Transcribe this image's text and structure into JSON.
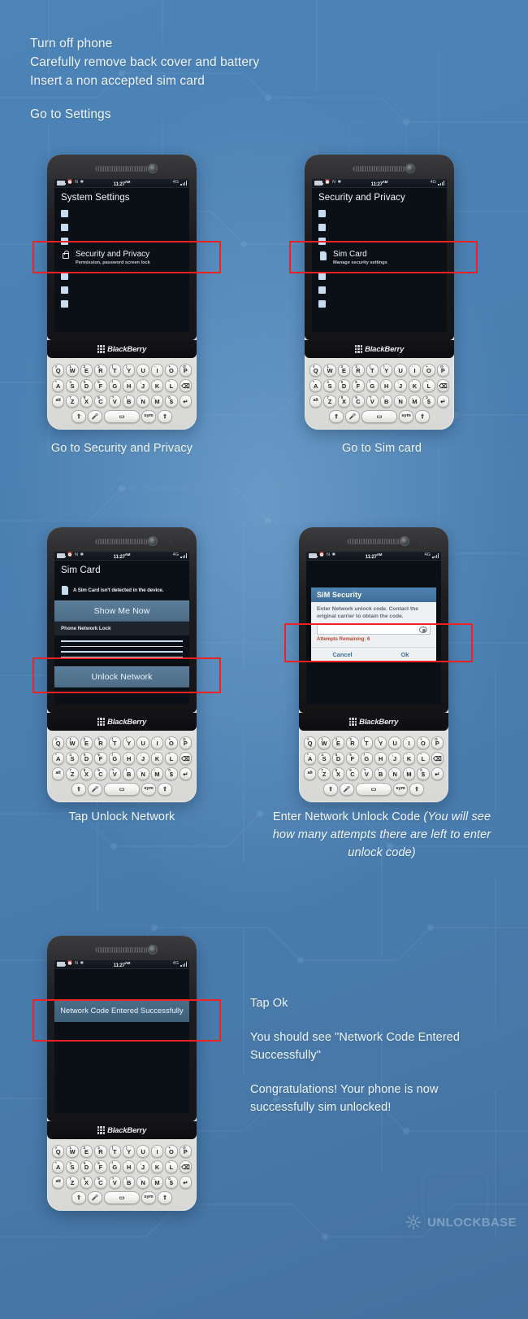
{
  "intro": {
    "lines": [
      "Turn off phone",
      "Carefully remove back cover and battery",
      "Insert a non accepted sim card"
    ],
    "settings_line": "Go to Settings"
  },
  "status_bar": {
    "time": "11:27",
    "time_suffix": "AM",
    "network": "4G",
    "icons": [
      "battery-icon",
      "alarm-icon",
      "n-icon",
      "bluetooth-icon"
    ]
  },
  "brand": "BlackBerry",
  "steps": [
    {
      "id": "step-1",
      "screen_title": "System Settings",
      "highlight_title": "Security and Privacy",
      "highlight_subtitle": "Permission, password screen lock",
      "highlight_icon": "lock-icon",
      "caption": "Go to Security and Privacy"
    },
    {
      "id": "step-2",
      "screen_title": "Security and Privacy",
      "highlight_title": "Sim Card",
      "highlight_subtitle": "Manage security settings",
      "highlight_icon": "sim-card-icon",
      "caption": "Go to Sim card"
    },
    {
      "id": "step-3",
      "screen_title": "Sim Card",
      "message": "A Sim Card isn't detected in the device.",
      "show_button": "Show Me Now",
      "section_header": "Phone Network Lock",
      "unlock_button": "Unlock Network",
      "caption": "Tap Unlock Network"
    },
    {
      "id": "step-4",
      "dialog": {
        "title": "SIM Security",
        "message": "Enter Network unlock code. Contact the original carrier to obtain the code.",
        "input_value": "",
        "reveal_icon": "eye-icon",
        "attempts": "Attempts Remaining: 6",
        "cancel": "Cancel",
        "ok": "Ok"
      },
      "caption_main": "Enter Network Unlock Code",
      "caption_italic": "(You will see how many attempts there are left to enter unlock code)"
    },
    {
      "id": "step-5",
      "toast": "Network Code Entered Successfully",
      "side_text": [
        "Tap Ok",
        "You should see \"Network Code Entered Successfully\"",
        "Congratulations! Your phone is now successfully sim unlocked!"
      ]
    }
  ],
  "keyboard": {
    "row1": [
      {
        "alt": "#",
        "key": "Q"
      },
      {
        "alt": "1",
        "key": "W"
      },
      {
        "alt": "2",
        "key": "E"
      },
      {
        "alt": "3",
        "key": "R"
      },
      {
        "alt": "(",
        "key": "T"
      },
      {
        "alt": ")",
        "key": "Y"
      },
      {
        "alt": "_",
        "key": "U"
      },
      {
        "alt": "-",
        "key": "I"
      },
      {
        "alt": "+",
        "key": "O"
      },
      {
        "alt": "@",
        "key": "P"
      }
    ],
    "row2": [
      {
        "alt": "*",
        "key": "A"
      },
      {
        "alt": "4",
        "key": "S"
      },
      {
        "alt": "5",
        "key": "D"
      },
      {
        "alt": "6",
        "key": "F"
      },
      {
        "alt": "/",
        "key": "G"
      },
      {
        "alt": ":",
        "key": "H"
      },
      {
        "alt": ";",
        "key": "J"
      },
      {
        "alt": "'",
        "key": "K"
      },
      {
        "alt": "\"",
        "key": "L"
      },
      {
        "alt": "",
        "key": "⌫"
      }
    ],
    "row3": [
      {
        "alt": "",
        "key": "alt"
      },
      {
        "alt": "7",
        "key": "Z"
      },
      {
        "alt": "8",
        "key": "X"
      },
      {
        "alt": "9",
        "key": "C"
      },
      {
        "alt": "?",
        "key": "V"
      },
      {
        "alt": "!",
        "key": "B"
      },
      {
        "alt": ",",
        "key": "N"
      },
      {
        "alt": ".",
        "key": "M"
      },
      {
        "alt": "0",
        "key": "$"
      },
      {
        "alt": "",
        "key": "↵"
      }
    ],
    "row4": [
      {
        "key": "⇧"
      },
      {
        "key": "🎤"
      },
      {
        "key": "space"
      },
      {
        "key": "sym"
      },
      {
        "key": "⇧"
      }
    ]
  },
  "watermark": {
    "mark": "unlock-logo-icon",
    "text_light": "UNLOCK",
    "text_bold": "BASE"
  },
  "colors": {
    "background": "#4a80b4",
    "accent_red": "#ee2222",
    "button_blue": "#4d6d88",
    "dialog_title": "#3f6e98",
    "attempts_red": "#b4442e"
  }
}
